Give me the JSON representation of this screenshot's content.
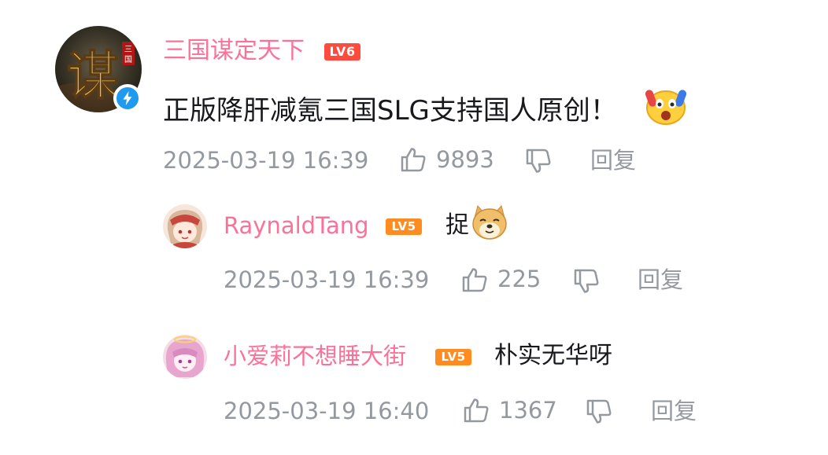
{
  "comments": [
    {
      "username": "三国谋定天下",
      "level": "LV6",
      "text": "正版降肝减氪三国SLG支持国人原创！",
      "emoji": "shocked-face-emoji",
      "time": "2025-03-19 16:39",
      "likes": "9893",
      "reply_label": "回复",
      "avatar_char": "谋",
      "avatar_small": "三国",
      "verified": true
    },
    {
      "username": "RaynaldTang",
      "level": "LV5",
      "text": "捉",
      "emoji": "doge-emoji",
      "time": "2025-03-19 16:39",
      "likes": "225",
      "reply_label": "回复"
    },
    {
      "username": "小爱莉不想睡大街",
      "level": "LV5",
      "text": "朴实无华呀",
      "time": "2025-03-19 16:40",
      "likes": "1367",
      "reply_label": "回复"
    }
  ],
  "colors": {
    "username": "#fb7299",
    "meta": "#9499a0",
    "text": "#18191c",
    "level6": "#ff4a3d",
    "level5": "#ff8c21",
    "verified": "#1e9bf0"
  }
}
